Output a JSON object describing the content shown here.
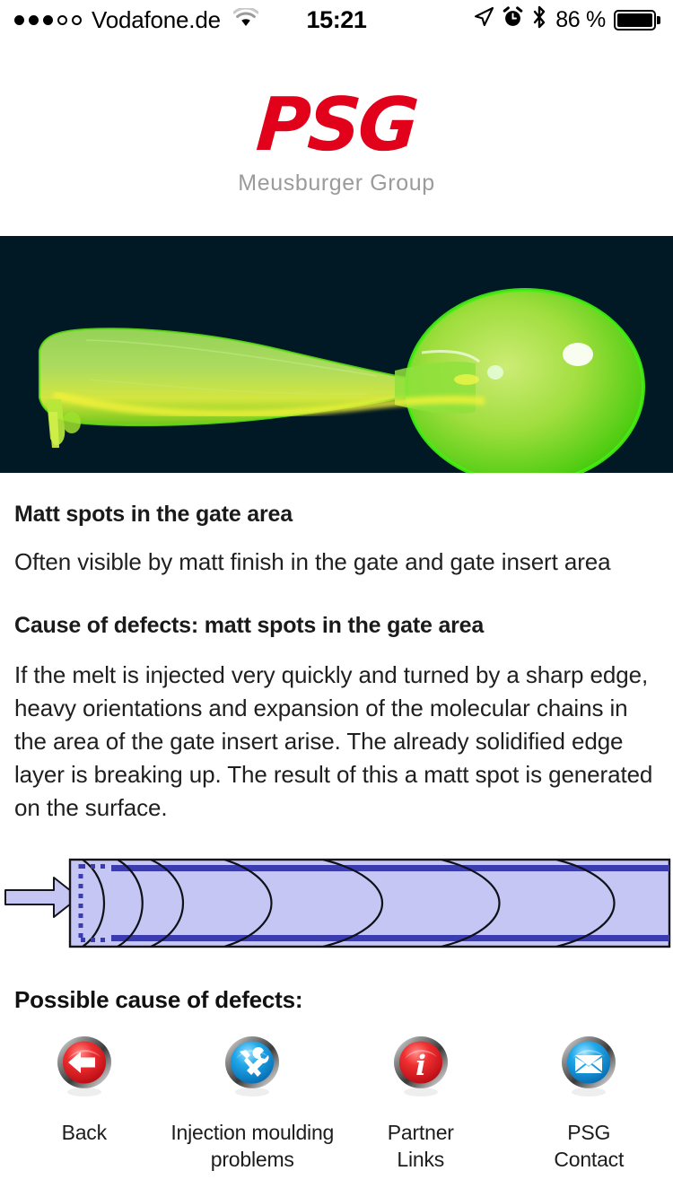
{
  "statusbar": {
    "carrier": "Vodafone.de",
    "signal_filled": 3,
    "signal_total": 5,
    "wifi_icon": "wifi-icon",
    "time": "15:21",
    "location_icon": "location-arrow-icon",
    "alarm_icon": "alarm-clock-icon",
    "bluetooth_icon": "bluetooth-icon",
    "battery_percent": "86 %",
    "battery_level": 86
  },
  "logo": {
    "brand": "PSG",
    "subtitle": "Meusburger Group",
    "brand_color": "#e2011a",
    "subtitle_color": "#9b9b9b"
  },
  "hero": {
    "name": "moulded-plastic-spoon-photo",
    "background_color": "#011825",
    "description": "Translucent green plastic spoon with gate stub"
  },
  "article": {
    "title": "Matt spots in the gate area",
    "intro": "Often visible by matt finish in the gate and gate insert area",
    "cause_title": "Cause of defects: matt spots in the gate area",
    "cause_body": "If the melt is injected very quickly and turned by a sharp edge, heavy orientations and expansion of the molecular chains in the area of the gate insert arise. The already solidified edge layer is breaking up.  The result of this a matt spot is generated on the surface."
  },
  "diagram": {
    "name": "melt-flow-front-diagram",
    "fill_color": "#c5c6f4",
    "band_color": "#3b3bb0",
    "outline_color": "#0f0f14",
    "gate_marker_color": "#3b3bb0",
    "arrow_label": "melt-injection-arrow",
    "flow_front_count": 7
  },
  "possible": {
    "heading": "Possible cause of defects:"
  },
  "nav": {
    "items": [
      {
        "icon": "back-arrow-icon",
        "label": "Back",
        "color": "#e8242a"
      },
      {
        "icon": "tools-icon",
        "label": "Injection moulding\nproblems",
        "label_line1": "Injection moulding",
        "label_line2": "problems",
        "color": "#1aa7e8"
      },
      {
        "icon": "info-icon",
        "label": "Partner\nLinks",
        "label_line1": "Partner",
        "label_line2": "Links",
        "color": "#e8242a"
      },
      {
        "icon": "envelope-icon",
        "label": "PSG\nContact",
        "label_line1": "PSG",
        "label_line2": "Contact",
        "color": "#1aa7e8"
      }
    ]
  }
}
